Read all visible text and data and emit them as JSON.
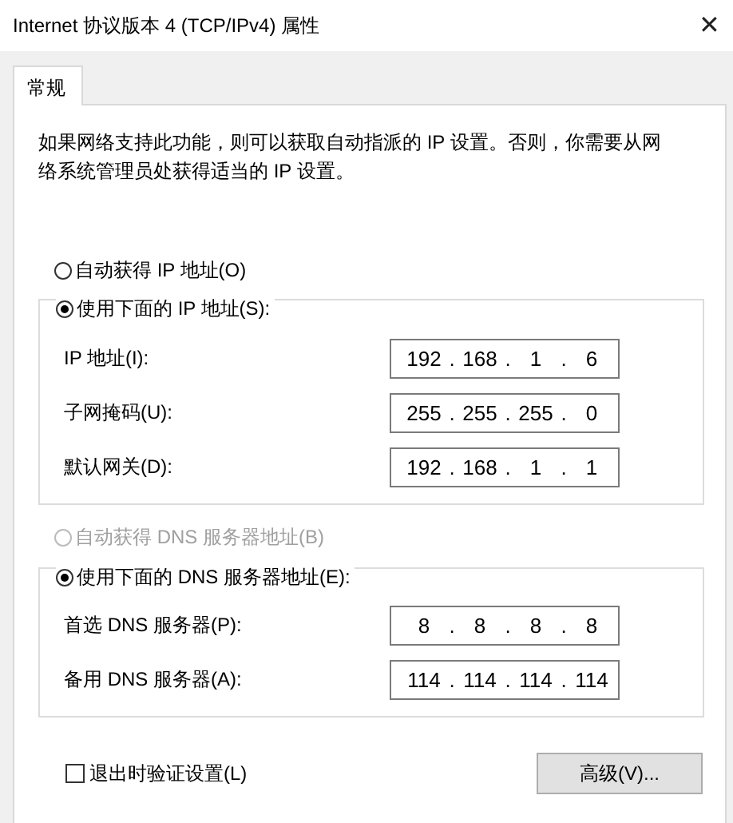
{
  "window": {
    "title": "Internet 协议版本 4 (TCP/IPv4) 属性",
    "close": "✕"
  },
  "tabs": [
    {
      "label": "常规",
      "selected": true
    }
  ],
  "description": "如果网络支持此功能，则可以获取自动指派的 IP 设置。否则，你需要从网络系统管理员处获得适当的 IP 设置。",
  "sections": [
    {
      "auto_option": {
        "label": "自动获得 IP 地址(O)",
        "selected": false,
        "disabled": false
      },
      "manual_option": {
        "label": "使用下面的 IP 地址(S):",
        "selected": true,
        "disabled": false
      },
      "fields": [
        {
          "label": "IP 地址(I):",
          "octets": [
            "192",
            "168",
            "1",
            "6"
          ],
          "separator": "."
        },
        {
          "label": "子网掩码(U):",
          "octets": [
            "255",
            "255",
            "255",
            "0"
          ],
          "separator": "."
        },
        {
          "label": "默认网关(D):",
          "octets": [
            "192",
            "168",
            "1",
            "1"
          ],
          "separator": "."
        }
      ]
    },
    {
      "auto_option": {
        "label": "自动获得 DNS 服务器地址(B)",
        "selected": false,
        "disabled": true
      },
      "manual_option": {
        "label": "使用下面的 DNS 服务器地址(E):",
        "selected": true,
        "disabled": false
      },
      "fields": [
        {
          "label": "首选 DNS 服务器(P):",
          "octets": [
            "8",
            "8",
            "8",
            "8"
          ],
          "separator": "."
        },
        {
          "label": "备用 DNS 服务器(A):",
          "octets": [
            "114",
            "114",
            "114",
            "114"
          ],
          "separator": "."
        }
      ]
    }
  ],
  "validate_checkbox": {
    "label": "退出时验证设置(L)",
    "checked": false
  },
  "advanced_button": "高级(V)..."
}
